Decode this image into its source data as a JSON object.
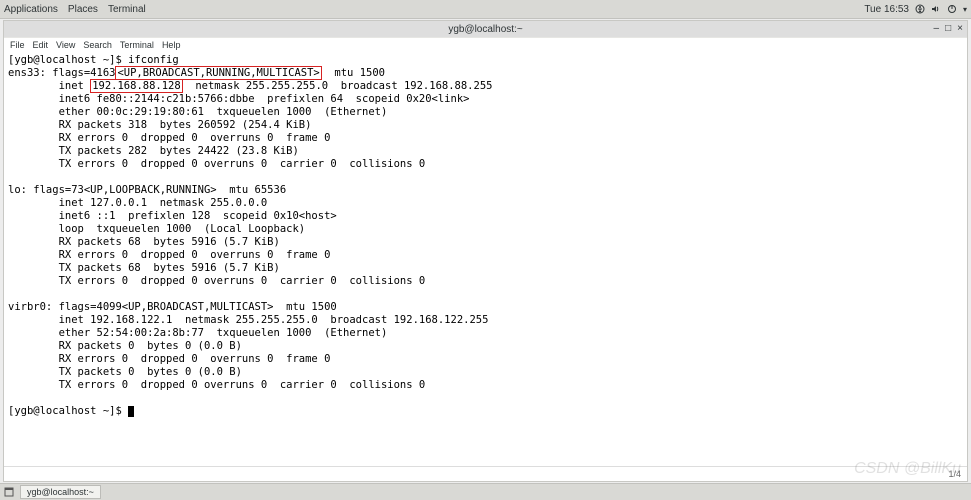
{
  "topbar": {
    "apps": "Applications",
    "places": "Places",
    "terminal": "Terminal",
    "clock": "Tue 16:53"
  },
  "window": {
    "title": "ygb@localhost:~",
    "menu": {
      "file": "File",
      "edit": "Edit",
      "view": "View",
      "search": "Search",
      "terminal": "Terminal",
      "help": "Help"
    },
    "status": "1/4"
  },
  "term": {
    "prompt1_a": "[ygb@localhost ~]$ ",
    "cmd1": "ifconfig",
    "ens_pre": "ens33: flags=4163",
    "ens_flags": "<UP,BROADCAST,RUNNING,MULTICAST>",
    "ens_mtu": "  mtu 1500",
    "ens_inet_pre": "        inet ",
    "ens_ip": "192.168.88.128",
    "ens_inet_post": "  netmask 255.255.255.0  broadcast 192.168.88.255",
    "ens_l3": "        inet6 fe80::2144:c21b:5766:dbbe  prefixlen 64  scopeid 0x20<link>",
    "ens_l4": "        ether 00:0c:29:19:80:61  txqueuelen 1000  (Ethernet)",
    "ens_l5": "        RX packets 318  bytes 260592 (254.4 KiB)",
    "ens_l6": "        RX errors 0  dropped 0  overruns 0  frame 0",
    "ens_l7": "        TX packets 282  bytes 24422 (23.8 KiB)",
    "ens_l8": "        TX errors 0  dropped 0 overruns 0  carrier 0  collisions 0",
    "lo_l1": "lo: flags=73<UP,LOOPBACK,RUNNING>  mtu 65536",
    "lo_l2": "        inet 127.0.0.1  netmask 255.0.0.0",
    "lo_l3": "        inet6 ::1  prefixlen 128  scopeid 0x10<host>",
    "lo_l4": "        loop  txqueuelen 1000  (Local Loopback)",
    "lo_l5": "        RX packets 68  bytes 5916 (5.7 KiB)",
    "lo_l6": "        RX errors 0  dropped 0  overruns 0  frame 0",
    "lo_l7": "        TX packets 68  bytes 5916 (5.7 KiB)",
    "lo_l8": "        TX errors 0  dropped 0 overruns 0  carrier 0  collisions 0",
    "vb_l1": "virbr0: flags=4099<UP,BROADCAST,MULTICAST>  mtu 1500",
    "vb_l2": "        inet 192.168.122.1  netmask 255.255.255.0  broadcast 192.168.122.255",
    "vb_l3": "        ether 52:54:00:2a:8b:77  txqueuelen 1000  (Ethernet)",
    "vb_l4": "        RX packets 0  bytes 0 (0.0 B)",
    "vb_l5": "        RX errors 0  dropped 0  overruns 0  frame 0",
    "vb_l6": "        TX packets 0  bytes 0 (0.0 B)",
    "vb_l7": "        TX errors 0  dropped 0 overruns 0  carrier 0  collisions 0",
    "prompt2": "[ygb@localhost ~]$ "
  },
  "taskbar": {
    "item1": "ygb@localhost:~"
  },
  "watermark": "CSDN @BillKu"
}
